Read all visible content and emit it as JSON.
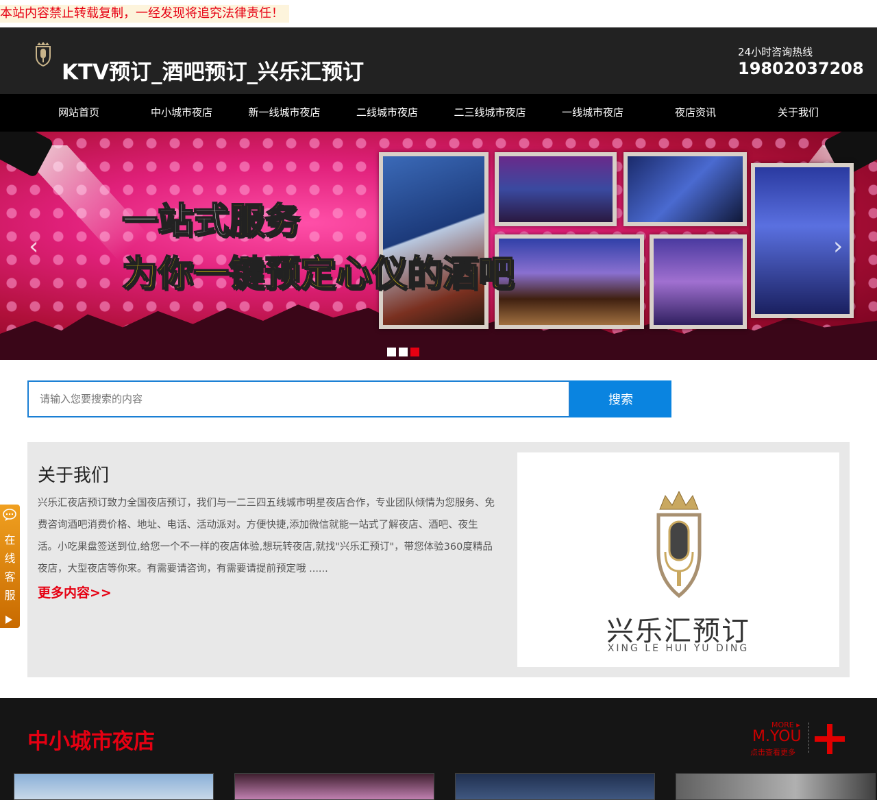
{
  "notice": "本站内容禁止转载复制，一经发现将追究法律责任！",
  "header": {
    "title": "KTV预订_酒吧预订_兴乐汇预订",
    "hotline_label": "24小时咨询热线",
    "hotline_number": "19802037208"
  },
  "nav": {
    "items": [
      {
        "label": "网站首页"
      },
      {
        "label": "中小城市夜店"
      },
      {
        "label": "新一线城市夜店"
      },
      {
        "label": "二线城市夜店"
      },
      {
        "label": "二三线城市夜店"
      },
      {
        "label": "一线城市夜店"
      },
      {
        "label": "夜店资讯"
      },
      {
        "label": "关于我们"
      }
    ]
  },
  "banner": {
    "slogan_line1_a": "一站式",
    "slogan_line1_b": "服务",
    "slogan_line2": "为你一键预定心仪的酒吧",
    "prev": "‹",
    "next": "›",
    "slide_count": 3,
    "active_slide": 3
  },
  "search": {
    "placeholder": "请输入您要搜索的内容",
    "button": "搜索"
  },
  "about": {
    "title": "关于我们",
    "text": "兴乐汇夜店预订致力全国夜店预订，我们与一二三四五线城市明星夜店合作，专业团队倾情为您服务、免费咨询酒吧消费价格、地址、电话、活动派对。方便快捷,添加微信就能一站式了解夜店、酒吧、夜生活。小吃果盘签送到位,给您一个不一样的夜店体验,想玩转夜店,就找\"兴乐汇预订\"，带您体验360度精品夜店，大型夜店等你来。有需要请咨询，有需要请提前预定哦 ......",
    "more": "更多内容>>",
    "brand_name": "兴乐汇预订",
    "brand_sub": "XING LE HUI YU DING"
  },
  "section": {
    "title": "中小城市夜店",
    "more_top": "MORE ▸",
    "more_mid": "M.YOU",
    "more_bot": "点击查看更多"
  },
  "chat": {
    "text": "在线客服"
  },
  "colors": {
    "accent_red": "#e60012",
    "search_blue": "#0a84e0",
    "chat_orange": "#f0a020"
  }
}
